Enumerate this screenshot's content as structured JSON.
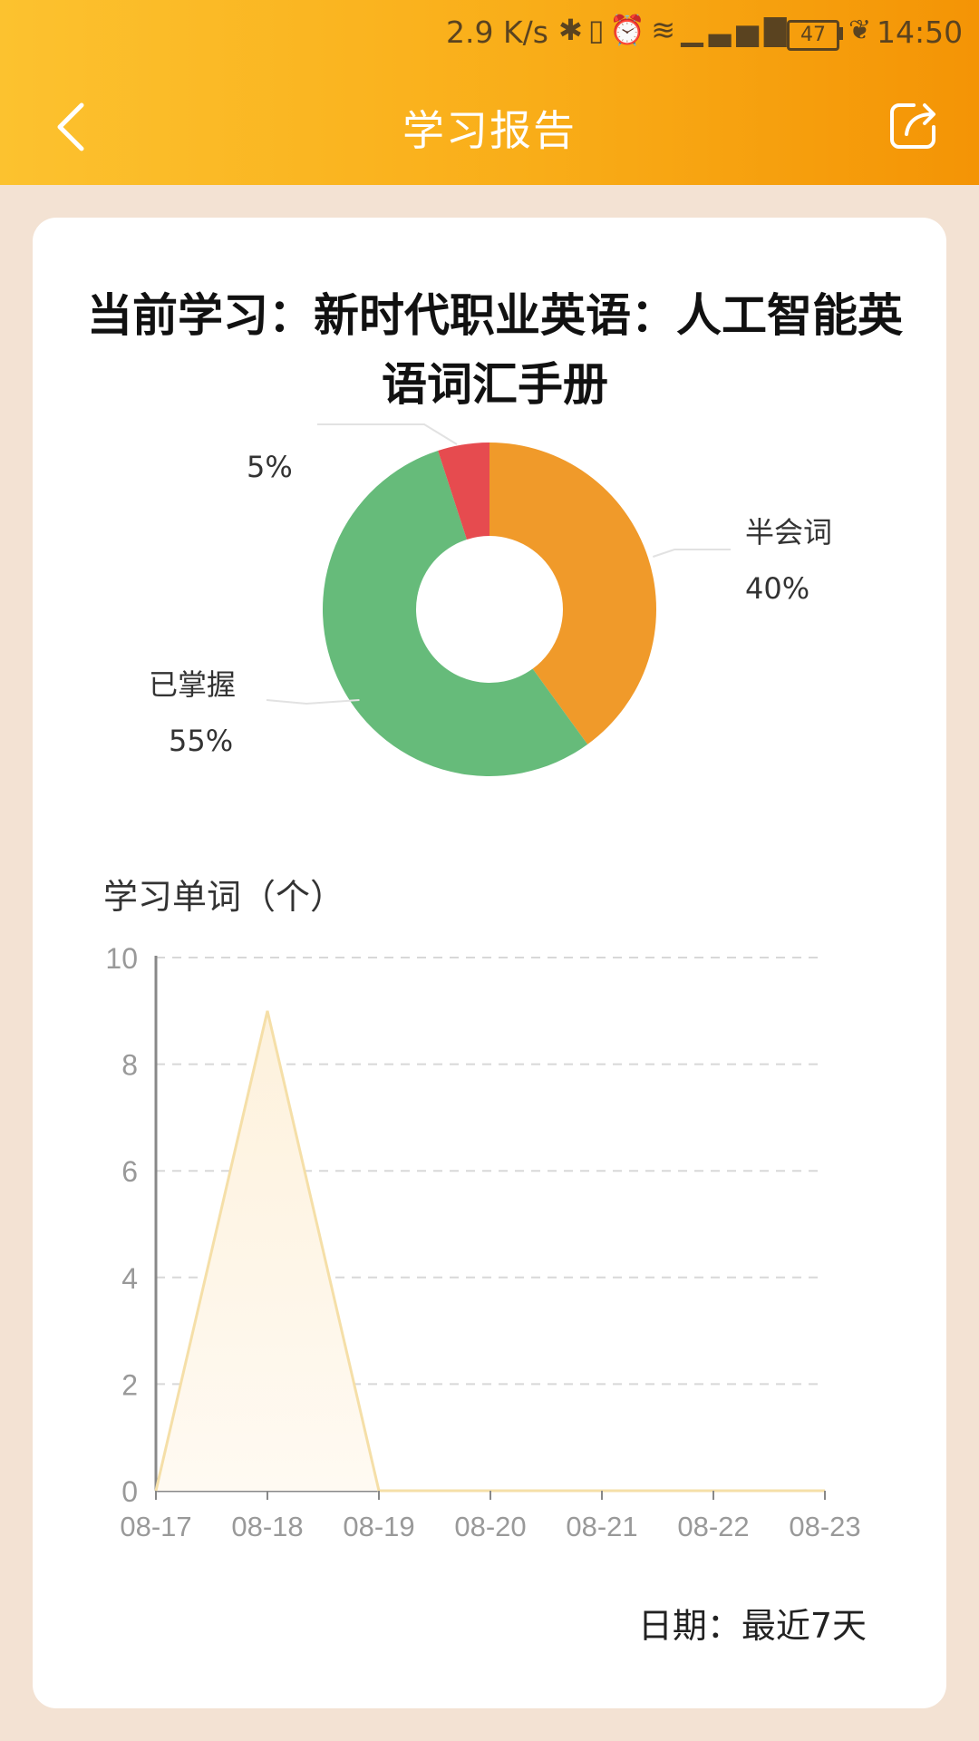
{
  "status_bar": {
    "network_speed": "2.9 K/s",
    "battery": "47",
    "time": "14:50",
    "icons": [
      "bluetooth-icon",
      "vibrate-icon",
      "alarm-icon",
      "wifi-icon",
      "signal-4g-icon",
      "battery-icon",
      "leaf-icon"
    ]
  },
  "header": {
    "title": "学习报告",
    "back_icon": "chevron-left-icon",
    "share_icon": "share-icon",
    "gradient": [
      "#fcc22f",
      "#f49405"
    ]
  },
  "card": {
    "title": "当前学习：新时代职业英语：人工智能英语词汇手册"
  },
  "chart_data": [
    {
      "type": "pie",
      "donut": true,
      "slices": [
        {
          "label": "半会词",
          "value": 40,
          "percent_label": "40%",
          "color": "#f09a2a"
        },
        {
          "label": "已掌握",
          "value": 55,
          "percent_label": "55%",
          "color": "#66bb7a"
        },
        {
          "label": "",
          "value": 5,
          "percent_label": "5%",
          "color": "#e64b4f"
        }
      ]
    },
    {
      "type": "area",
      "title": "学习单词（个）",
      "x": [
        "08-17",
        "08-18",
        "08-19",
        "08-20",
        "08-21",
        "08-22",
        "08-23"
      ],
      "y": [
        0,
        9,
        0,
        0,
        0,
        0,
        0
      ],
      "ylim": [
        0,
        10
      ],
      "yticks": [
        0,
        2,
        4,
        6,
        8,
        10
      ],
      "grid": true,
      "line_color": "#f5dfa8",
      "fill_color": "#fdf1dc",
      "xlabel": "日期：最近7天"
    }
  ]
}
